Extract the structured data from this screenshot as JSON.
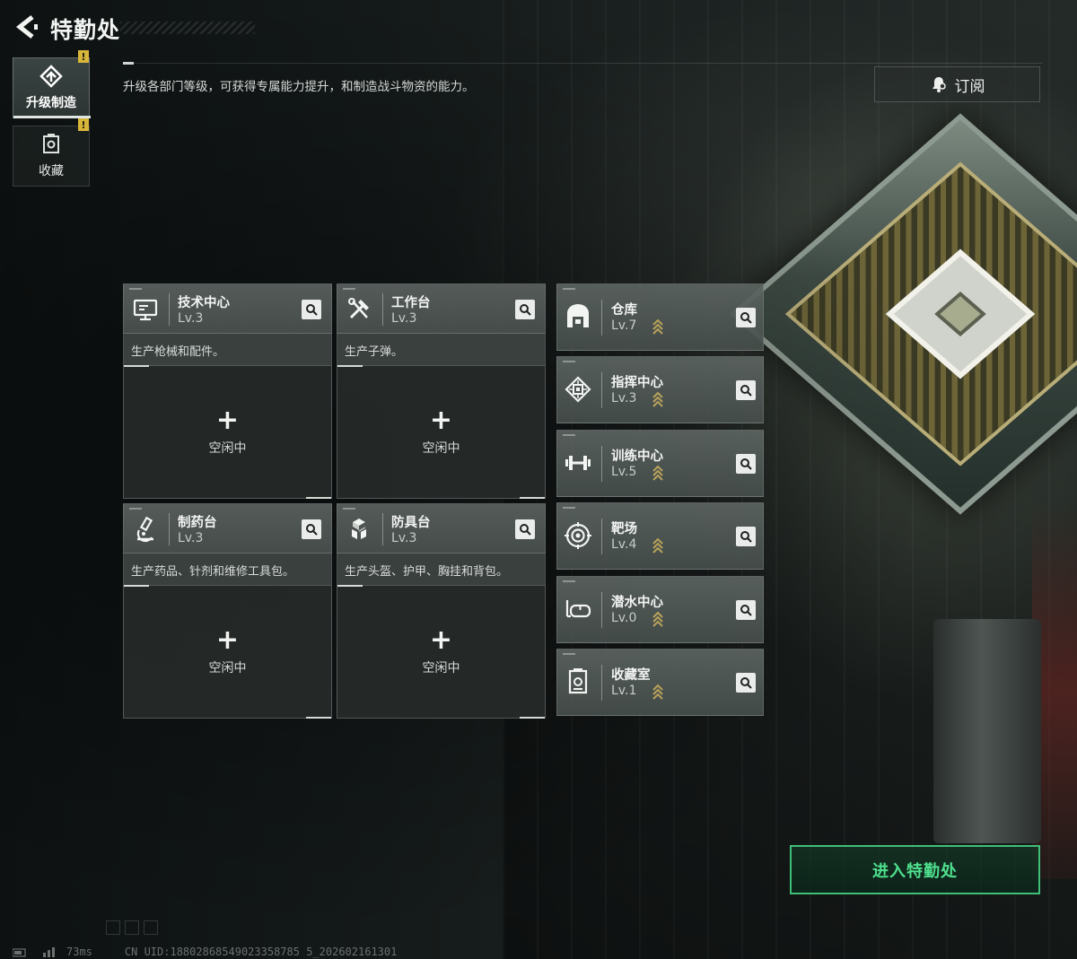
{
  "header": {
    "title": "特勤处",
    "description": "升级各部门等级，可获得专属能力提升，和制造战斗物资的能力。",
    "subscribe_label": "订阅"
  },
  "sidebar": {
    "items": [
      {
        "label": "升级制造",
        "icon": "upgrade-craft-icon",
        "active": true,
        "badge": "!"
      },
      {
        "label": "收藏",
        "icon": "collection-icon",
        "active": false,
        "badge": "!"
      }
    ]
  },
  "production": [
    {
      "name": "技术中心",
      "level": "Lv.3",
      "description": "生产枪械和配件。",
      "slot_plus": "+",
      "slot_status": "空闲中",
      "icon": "monitor-icon"
    },
    {
      "name": "工作台",
      "level": "Lv.3",
      "description": "生产子弹。",
      "slot_plus": "+",
      "slot_status": "空闲中",
      "icon": "tools-icon"
    },
    {
      "name": "制药台",
      "level": "Lv.3",
      "description": "生产药品、针剂和维修工具包。",
      "slot_plus": "+",
      "slot_status": "空闲中",
      "icon": "microscope-icon"
    },
    {
      "name": "防具台",
      "level": "Lv.3",
      "description": "生产头盔、护甲、胸挂和背包。",
      "slot_plus": "+",
      "slot_status": "空闲中",
      "icon": "armor-boxes-icon"
    }
  ],
  "facilities": [
    {
      "name": "仓库",
      "level": "Lv.7",
      "icon": "warehouse-icon"
    },
    {
      "name": "指挥中心",
      "level": "Lv.3",
      "icon": "chip-icon"
    },
    {
      "name": "训练中心",
      "level": "Lv.5",
      "icon": "dumbbell-icon"
    },
    {
      "name": "靶场",
      "level": "Lv.4",
      "icon": "target-icon"
    },
    {
      "name": "潜水中心",
      "level": "Lv.0",
      "icon": "diving-mask-icon"
    },
    {
      "name": "收藏室",
      "level": "Lv.1",
      "icon": "collection-room-icon"
    }
  ],
  "enter_button": "进入特勤处",
  "footer": {
    "ping": "73ms",
    "uid": "CN UID:18802868549023358785 5_202602161301"
  },
  "colors": {
    "accent_green": "#4fe08e",
    "badge_yellow": "#d8b63a",
    "upgrade_arrow": "#b9a25a"
  }
}
